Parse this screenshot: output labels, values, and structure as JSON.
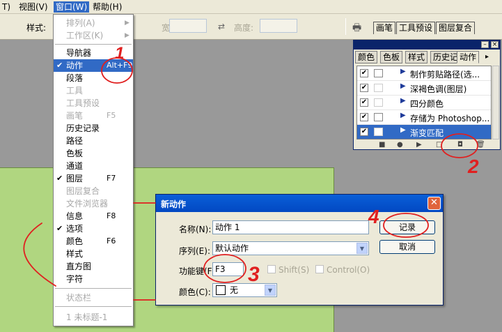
{
  "menubar": {
    "items": [
      {
        "label": "T)"
      },
      {
        "label": "视图(V)"
      },
      {
        "label": "窗口(W)"
      },
      {
        "label": "帮助(H)"
      }
    ]
  },
  "options": {
    "style_label": "样式:",
    "width_label": "宽度:",
    "height_label": "高度:",
    "palette_well_tabs": [
      "画笔",
      "工具预设",
      "图层复合"
    ]
  },
  "window_menu": {
    "items": [
      {
        "label": "排列(A)",
        "disabled": true,
        "submenu": true
      },
      {
        "label": "工作区(K)",
        "disabled": true,
        "submenu": true
      },
      {
        "label": "导航器"
      },
      {
        "label": "动作",
        "checked": true,
        "shortcut": "Alt+F9",
        "highlighted": true
      },
      {
        "label": "段落"
      },
      {
        "label": "工具",
        "disabled": true
      },
      {
        "label": "工具预设",
        "disabled": true
      },
      {
        "label": "画笔",
        "disabled": true,
        "shortcut": "F5"
      },
      {
        "label": "历史记录"
      },
      {
        "label": "路径"
      },
      {
        "label": "色板"
      },
      {
        "label": "通道"
      },
      {
        "label": "图层",
        "checked": true,
        "shortcut": "F7"
      },
      {
        "label": "图层复合",
        "disabled": true
      },
      {
        "label": "文件浏览器",
        "disabled": true
      },
      {
        "label": "信息",
        "shortcut": "F8"
      },
      {
        "label": "选项",
        "checked": true
      },
      {
        "label": "颜色",
        "shortcut": "F6"
      },
      {
        "label": "样式"
      },
      {
        "label": "直方图"
      },
      {
        "label": "字符"
      },
      {
        "label": "状态栏",
        "disabled": true
      },
      {
        "label": "1 未标题-1",
        "disabled": true
      }
    ]
  },
  "actions_panel": {
    "tabs": [
      "颜色",
      "色板",
      "样式",
      "历史记",
      "动作"
    ],
    "active_tab": "动作",
    "rows": [
      {
        "name": "制作剪贴路径(选...",
        "checked": true,
        "dialog": true
      },
      {
        "name": "深褐色调(图层)",
        "checked": true,
        "dialog": false
      },
      {
        "name": "四分颜色",
        "checked": true,
        "dialog": false
      },
      {
        "name": "存储为 Photoshop...",
        "checked": true,
        "dialog": true
      },
      {
        "name": "渐变匹配",
        "checked": true,
        "dialog": false,
        "selected": true
      }
    ]
  },
  "dialog": {
    "title": "新动作",
    "name_label": "名称(N):",
    "name_value": "动作 1",
    "set_label": "序列(E):",
    "set_value": "默认动作",
    "fkey_label": "功能键(F)",
    "fkey_value": "F3",
    "shift_label": "Shift(S)",
    "control_label": "Control(O)",
    "color_label": "颜色(C):",
    "color_value": "无",
    "record_button": "记录",
    "cancel_button": "取消"
  },
  "annotations": [
    "1",
    "2",
    "3",
    "4"
  ],
  "colors": {
    "canvas": "#b0d680",
    "highlight": "#316ac5",
    "annotation": "#e02020"
  }
}
